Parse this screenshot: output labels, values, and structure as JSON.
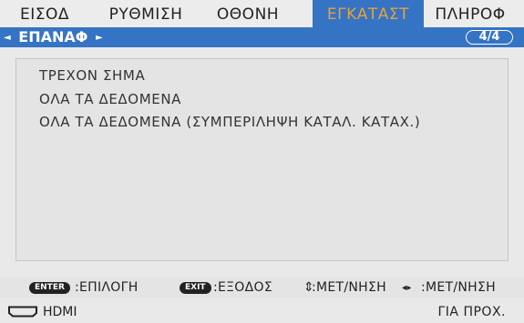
{
  "tabs": [
    {
      "label": "ΕΙΣΟΔ"
    },
    {
      "label": "ΡΥΘΜΙΣΗ"
    },
    {
      "label": "ΟΘΟΝΗ"
    },
    {
      "label": "ΕΓΚΑΤΑΣΤ"
    },
    {
      "label": "ΠΛΗΡΟΦ"
    }
  ],
  "active_tab": "ΕΓΚΑΤΑΣΤ",
  "submenu": {
    "title": "ΕΠΑΝΑΦ",
    "left_arrow": "◄",
    "right_arrow": "►",
    "page": "4/4"
  },
  "options": [
    {
      "label": "ΤΡΕΧΟΝ ΣΗΜΑ"
    },
    {
      "label": "ΟΛΑ ΤΑ ΔΕΔΟΜΕΝΑ"
    },
    {
      "label": "ΟΛΑ ΤΑ ΔΕΔΟΜΕΝΑ (ΣΥΜΠΕΡΙΛΗΨΗ ΚΑΤΑΛ. ΚΑΤΑΧ.)"
    }
  ],
  "hints": {
    "enter_key": "ENTER",
    "enter_action": ":ΕΠΙΛΟΓΗ",
    "exit_key": "EXIT",
    "exit_action": ":ΕΞΟΔΟΣ",
    "updown_icon": "⇕",
    "updown_action": ":ΜΕΤ/ΝΗΣΗ",
    "leftright_icon": "◂▸",
    "leftright_action": ":ΜΕΤ/ΝΗΣΗ"
  },
  "status": {
    "source": "HDMI",
    "info": "ΓΙΑ ΠΡΟΧ."
  },
  "colors": {
    "accent": "#3574c4",
    "active_tab_text": "#e9a03a",
    "background": "#e9e9e9"
  }
}
